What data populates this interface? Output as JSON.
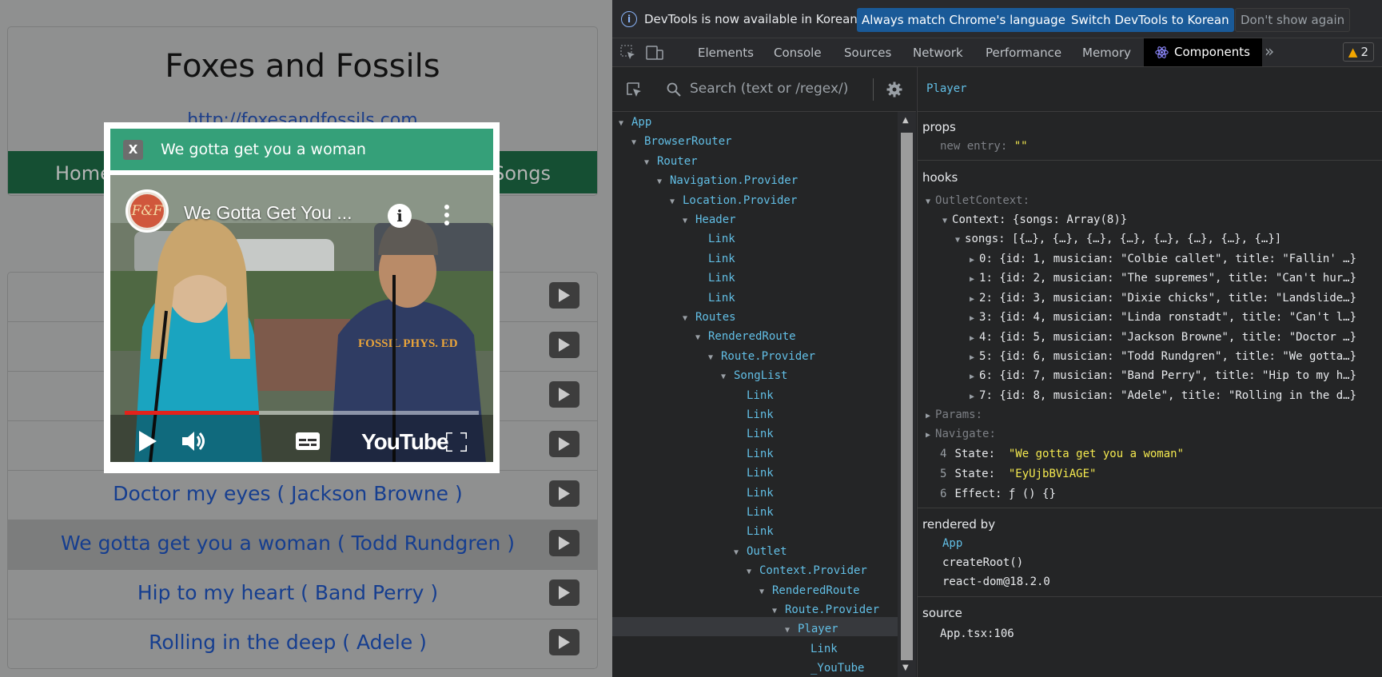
{
  "app": {
    "site_title": "Foxes and Fossils",
    "site_link": "http://foxesandfossils.com",
    "nav_home": "Home",
    "nav_songs": "Songs",
    "songs": [
      {
        "label": ""
      },
      {
        "label": ""
      },
      {
        "label": ""
      },
      {
        "label": ""
      },
      {
        "label": "Doctor my eyes ( Jackson Browne )"
      },
      {
        "label": "We gotta get you a woman ( Todd Rundgren )"
      },
      {
        "label": "Hip to my heart ( Band Perry )"
      },
      {
        "label": "Rolling in the deep ( Adele )"
      }
    ],
    "modal": {
      "close_label": "X",
      "title": "We gotta get you a woman",
      "video_title": "We Gotta Get You ...",
      "channel_initials": "F&F",
      "info_label": "i",
      "youtube_label": "YouTube",
      "progress": 0.38
    }
  },
  "devtools": {
    "infobar": {
      "message": "DevTools is now available in Korean!",
      "btn_match": "Always match Chrome's language",
      "btn_switch": "Switch DevTools to Korean",
      "btn_dismiss": "Don't show again"
    },
    "tabs": {
      "elements": "Elements",
      "console": "Console",
      "sources": "Sources",
      "network": "Network",
      "performance": "Performance",
      "memory": "Memory",
      "components": "Components",
      "more": "»",
      "warning_count": "2"
    },
    "search_placeholder": "Search (text or /regex/)",
    "tree": [
      {
        "label": "App",
        "depth": 0,
        "arrow": "▼"
      },
      {
        "label": "BrowserRouter",
        "depth": 1,
        "arrow": "▼"
      },
      {
        "label": "Router",
        "depth": 2,
        "arrow": "▼"
      },
      {
        "label": "Navigation.Provider",
        "depth": 3,
        "arrow": "▼"
      },
      {
        "label": "Location.Provider",
        "depth": 4,
        "arrow": "▼"
      },
      {
        "label": "Header",
        "depth": 5,
        "arrow": "▼"
      },
      {
        "label": "Link",
        "depth": 6,
        "arrow": ""
      },
      {
        "label": "Link",
        "depth": 6,
        "arrow": ""
      },
      {
        "label": "Link",
        "depth": 6,
        "arrow": ""
      },
      {
        "label": "Link",
        "depth": 6,
        "arrow": ""
      },
      {
        "label": "Routes",
        "depth": 5,
        "arrow": "▼"
      },
      {
        "label": "RenderedRoute",
        "depth": 6,
        "arrow": "▼"
      },
      {
        "label": "Route.Provider",
        "depth": 7,
        "arrow": "▼"
      },
      {
        "label": "SongList",
        "depth": 8,
        "arrow": "▼"
      },
      {
        "label": "Link",
        "depth": 9,
        "arrow": ""
      },
      {
        "label": "Link",
        "depth": 9,
        "arrow": ""
      },
      {
        "label": "Link",
        "depth": 9,
        "arrow": ""
      },
      {
        "label": "Link",
        "depth": 9,
        "arrow": ""
      },
      {
        "label": "Link",
        "depth": 9,
        "arrow": ""
      },
      {
        "label": "Link",
        "depth": 9,
        "arrow": ""
      },
      {
        "label": "Link",
        "depth": 9,
        "arrow": ""
      },
      {
        "label": "Link",
        "depth": 9,
        "arrow": ""
      },
      {
        "label": "Outlet",
        "depth": 9,
        "arrow": "▼"
      },
      {
        "label": "Context.Provider",
        "depth": 10,
        "arrow": "▼"
      },
      {
        "label": "RenderedRoute",
        "depth": 11,
        "arrow": "▼"
      },
      {
        "label": "Route.Provider",
        "depth": 12,
        "arrow": "▼"
      },
      {
        "label": "Player",
        "depth": 13,
        "arrow": "▼"
      },
      {
        "label": "Link",
        "depth": 14,
        "arrow": ""
      },
      {
        "label": "_YouTube",
        "depth": 14,
        "arrow": ""
      }
    ],
    "details": {
      "component": "Player",
      "props_title": "props",
      "prop_key": "new entry",
      "prop_value": "\"\"",
      "hooks_title": "hooks",
      "outlet_context": "OutletContext:",
      "context_line": "Context: {songs: Array(8)}",
      "songs_line": "songs: [{…}, {…}, {…}, {…}, {…}, {…}, {…}, {…}]",
      "song_entries": [
        "0: {id: 1, musician: \"Colbie callet\", title: \"Fallin' …}",
        "1: {id: 2, musician: \"The supremes\", title: \"Can't hur…}",
        "2: {id: 3, musician: \"Dixie chicks\", title: \"Landslide…}",
        "3: {id: 4, musician: \"Linda ronstadt\", title: \"Can't l…}",
        "4: {id: 5, musician: \"Jackson Browne\", title: \"Doctor …}",
        "5: {id: 6, musician: \"Todd Rundgren\", title: \"We gotta…}",
        "6: {id: 7, musician: \"Band Perry\", title: \"Hip to my h…}",
        "7: {id: 8, musician: \"Adele\", title: \"Rolling in the d…}"
      ],
      "params": "Params:",
      "navigate": "Navigate:",
      "state1_index": "4",
      "state1_key": "State:",
      "state1_value": "\"We gotta get you a woman\"",
      "state2_index": "5",
      "state2_key": "State:",
      "state2_value": "\"EyUjbBViAGE\"",
      "effect_index": "6",
      "effect_key": "Effect:",
      "effect_value": "ƒ () {}",
      "rendered_by_title": "rendered by",
      "rendered_by": [
        "App",
        "createRoot()",
        "react-dom@18.2.0"
      ],
      "source_title": "source",
      "source_value": "App.tsx:106"
    }
  },
  "colors": {
    "nav_green": "#154f33",
    "modal_header": "#35a079",
    "devtools_bg": "#202124",
    "component_blue": "#62bfe6",
    "string_yellow": "#f4e94f"
  }
}
